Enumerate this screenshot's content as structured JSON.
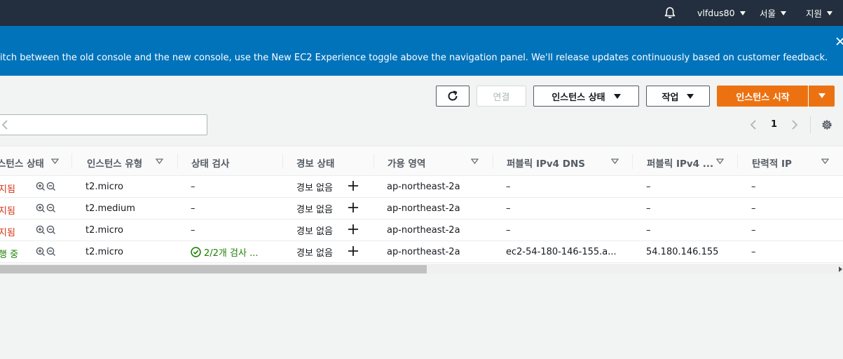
{
  "topbar": {
    "user": "vlfdus80",
    "region": "서울",
    "support": "지원",
    "icons": [
      "bell-icon",
      "caret-down-icon"
    ]
  },
  "banner": {
    "message": "itch between the old console and the new console, use the New EC2 Experience toggle above the navigation panel. We'll release updates continuously based on customer feedback.",
    "close_icon": "close-icon"
  },
  "toolbar": {
    "refresh_icon": "refresh-icon",
    "connect_label": "연결",
    "instance_state_label": "인스턴스 상태",
    "actions_label": "작업",
    "launch_label": "인스턴스 시작"
  },
  "search": {
    "value": "",
    "placeholder": ""
  },
  "pagination": {
    "current_page": "1"
  },
  "colors": {
    "topbar": "#232f3e",
    "banner": "#0073bb",
    "primary": "#ec7211",
    "stopped": "#d13212",
    "running": "#1d8102"
  },
  "table": {
    "columns": [
      "스턴스 상태",
      "인스턴스 유형",
      "상태 검사",
      "경보 상태",
      "가용 영역",
      "퍼블릭 IPv4 DNS",
      "퍼블릭 IPv4 ...",
      "탄력적 IP"
    ],
    "rows": [
      {
        "state": "지됨",
        "state_kind": "stopped",
        "type": "t2.micro",
        "status_check": "–",
        "alarm": "경보 없음",
        "az": "ap-northeast-2a",
        "dns": "–",
        "ipv4": "–",
        "eip": "–"
      },
      {
        "state": "지됨",
        "state_kind": "stopped",
        "type": "t2.medium",
        "status_check": "–",
        "alarm": "경보 없음",
        "az": "ap-northeast-2a",
        "dns": "–",
        "ipv4": "–",
        "eip": "–"
      },
      {
        "state": "지됨",
        "state_kind": "stopped",
        "type": "t2.micro",
        "status_check": "–",
        "alarm": "경보 없음",
        "az": "ap-northeast-2a",
        "dns": "–",
        "ipv4": "–",
        "eip": "–"
      },
      {
        "state": "행 중",
        "state_kind": "running",
        "type": "t2.micro",
        "status_check": "2/2개 검사 ...",
        "alarm": "경보 없음",
        "az": "ap-northeast-2a",
        "dns": "ec2-54-180-146-155.a...",
        "ipv4": "54.180.146.155",
        "eip": "–"
      }
    ]
  }
}
